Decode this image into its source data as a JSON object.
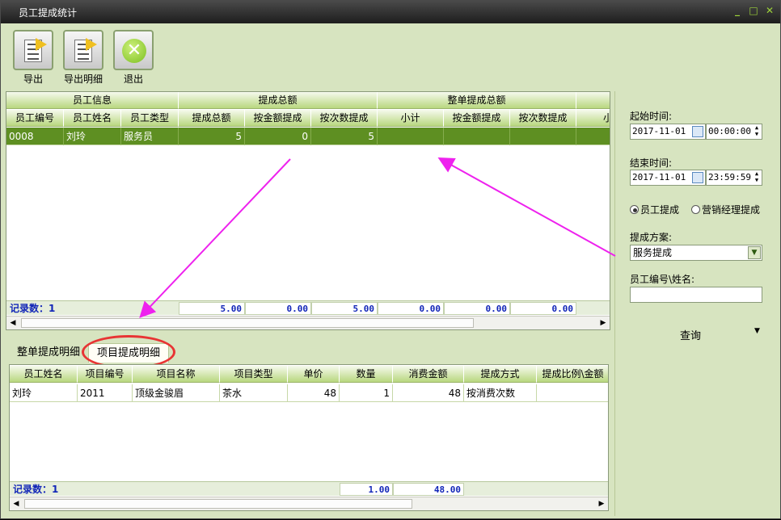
{
  "window": {
    "title": "员工提成统计"
  },
  "toolbar": {
    "export": "导出",
    "export_detail": "导出明细",
    "exit": "退出"
  },
  "top_grid": {
    "groups": [
      "员工信息",
      "提成总额",
      "整单提成总额"
    ],
    "columns": [
      "员工编号",
      "员工姓名",
      "员工类型",
      "提成总额",
      "按金额提成",
      "按次数提成",
      "小计",
      "按金额提成",
      "按次数提成",
      "小"
    ],
    "rows": [
      [
        "0008",
        "刘玲",
        "服务员",
        "5",
        "0",
        "5",
        "",
        "",
        "",
        ""
      ]
    ],
    "footer": {
      "record_label": "记录数：1",
      "totals": [
        "5.00",
        "0.00",
        "5.00",
        "0.00",
        "0.00",
        "0.00"
      ]
    }
  },
  "tabs": [
    "整单提成明细",
    "项目提成明细"
  ],
  "bottom_grid": {
    "columns": [
      "员工姓名",
      "项目编号",
      "项目名称",
      "项目类型",
      "单价",
      "数量",
      "消费金额",
      "提成方式",
      "提成比例\\金额"
    ],
    "rows": [
      [
        "刘玲",
        "2011",
        "顶级金骏眉",
        "茶水",
        "48",
        "1",
        "48",
        "按消费次数",
        ""
      ]
    ],
    "footer": {
      "record_label": "记录数：1",
      "totals": [
        "1.00",
        "48.00"
      ]
    }
  },
  "filters": {
    "start_label": "起始时间:",
    "start_date": "2017-11-01",
    "start_time": "00:00:00",
    "end_label": "结束时间:",
    "end_date": "2017-11-01",
    "end_time": "23:59:59",
    "radio_employee": "员工提成",
    "radio_manager": "营销经理提成",
    "scheme_label": "提成方案:",
    "scheme_value": "服务提成",
    "emp_label": "员工编号\\姓名:",
    "emp_value": "",
    "query": "查询"
  },
  "colors": {
    "header_green": "#b8d77f",
    "selected_row": "#5e8f22",
    "panel_bg": "#d7e4c0",
    "annotation_magenta": "#ee22ee",
    "annotation_red": "#e83434"
  }
}
